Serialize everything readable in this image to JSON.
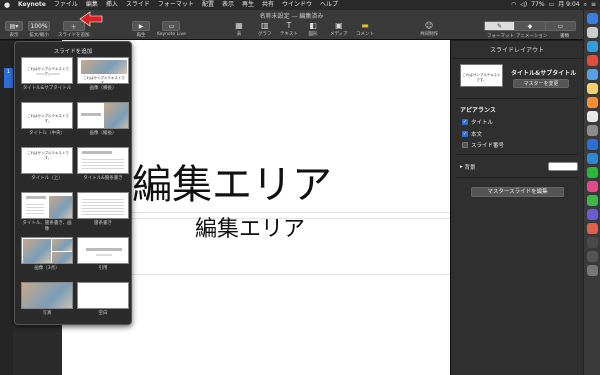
{
  "menubar": {
    "apple": "",
    "items": [
      "Keynote",
      "ファイル",
      "編集",
      "挿入",
      "スライド",
      "フォーマット",
      "配置",
      "表示",
      "再生",
      "共有",
      "ウインドウ",
      "ヘルプ"
    ],
    "battery": "77%",
    "clock": "月 9:04"
  },
  "toolbar": {
    "doc_title": "名称未設定 — 編集済み",
    "view_label": "表示",
    "zoom_value": "100%",
    "zoom_label": "拡大/縮小",
    "add_slide_label": "スライドを追加",
    "play_label": "再生",
    "keynote_live_label": "Keynote Live",
    "table_label": "表",
    "chart_label": "グラフ",
    "text_label": "テキスト",
    "shape_label": "図形",
    "media_label": "メディア",
    "comment_label": "コメント",
    "collab_label": "共同制作",
    "format_label": "フォーマット",
    "animate_label": "アニメーション",
    "document_label": "書類"
  },
  "navigator": {
    "slide_number": "1"
  },
  "slide": {
    "title": "編集エリア",
    "subtitle": "編集エリア"
  },
  "popover": {
    "title": "スライドを追加",
    "layouts": [
      {
        "label": "タイトル&サブタイトル",
        "thumb_text": "これはサンプルテキストです。"
      },
      {
        "label": "画像（横長）",
        "thumb_text": "これはサンプルテキストです。"
      },
      {
        "label": "タイトル（中央）",
        "thumb_text": "これはサンプルテキストです。"
      },
      {
        "label": "画像（縦長）",
        "thumb_text": ""
      },
      {
        "label": "タイトル（上）",
        "thumb_text": "これはサンプルテキストです。"
      },
      {
        "label": "タイトル&箇条書き",
        "thumb_text": ""
      },
      {
        "label": "タイトル、箇条書き、画像",
        "thumb_text": ""
      },
      {
        "label": "箇条書き",
        "thumb_text": ""
      },
      {
        "label": "画像（3点）",
        "thumb_text": ""
      },
      {
        "label": "引用",
        "thumb_text": ""
      },
      {
        "label": "写真",
        "thumb_text": ""
      },
      {
        "label": "空白",
        "thumb_text": ""
      }
    ]
  },
  "inspector": {
    "header": "スライドレイアウト",
    "layout_thumb_text": "これはサンプルテキストです。",
    "layout_name": "タイトル&サブタイトル",
    "change_master": "マスターを変更",
    "appearance": "アピアランス",
    "checkbox_title": "タイトル",
    "checkbox_body": "本文",
    "checkbox_slide_number": "スライド番号",
    "background_label": "背景",
    "edit_master": "マスタースライドを編集"
  },
  "colors": {
    "accent": "#2d6fd6",
    "annotation_arrow": "#e02020"
  }
}
